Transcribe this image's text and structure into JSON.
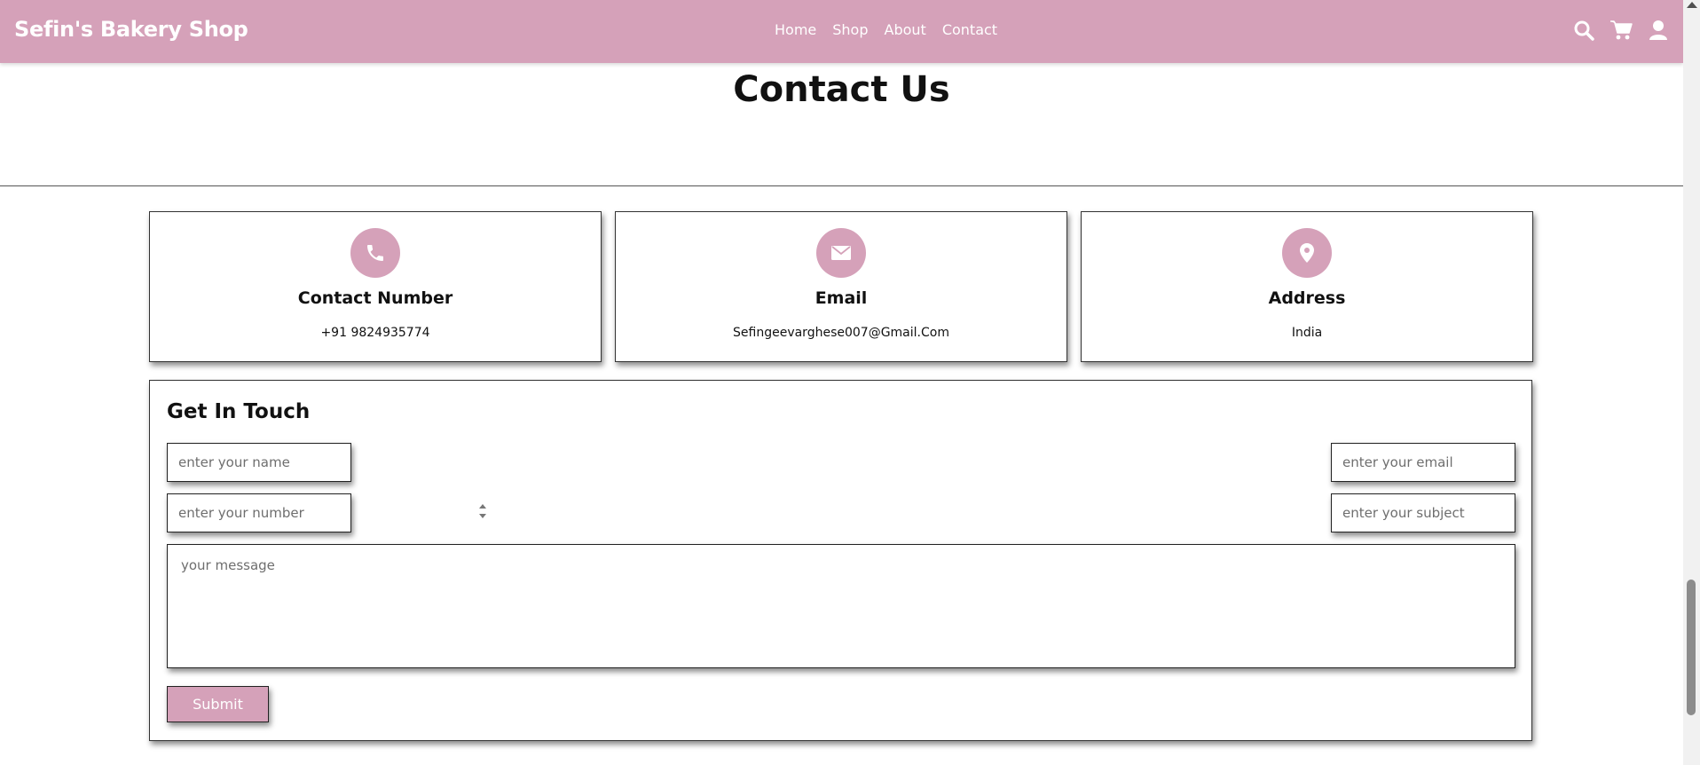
{
  "header": {
    "logo": "Sefin's Bakery Shop",
    "nav": [
      "Home",
      "Shop",
      "About",
      "Contact"
    ],
    "icons": [
      "search-icon",
      "cart-icon",
      "user-icon"
    ],
    "background_color": "#d5a1b9"
  },
  "page_title": "Contact Us",
  "cards": [
    {
      "icon": "phone-icon",
      "title": "Contact Number",
      "value": "+91 9824935774"
    },
    {
      "icon": "envelope-icon",
      "title": "Email",
      "value": "Sefingeevarghese007@Gmail.Com"
    },
    {
      "icon": "location-pin-icon",
      "title": "Address",
      "value": "India"
    }
  ],
  "form": {
    "title": "Get In Touch",
    "name_placeholder": "enter your name",
    "email_placeholder": "enter your email",
    "number_placeholder": "enter your number",
    "subject_placeholder": "enter your subject",
    "message_placeholder": "your message",
    "submit_label": "Submit"
  },
  "accent_color": "#d5a1b9"
}
